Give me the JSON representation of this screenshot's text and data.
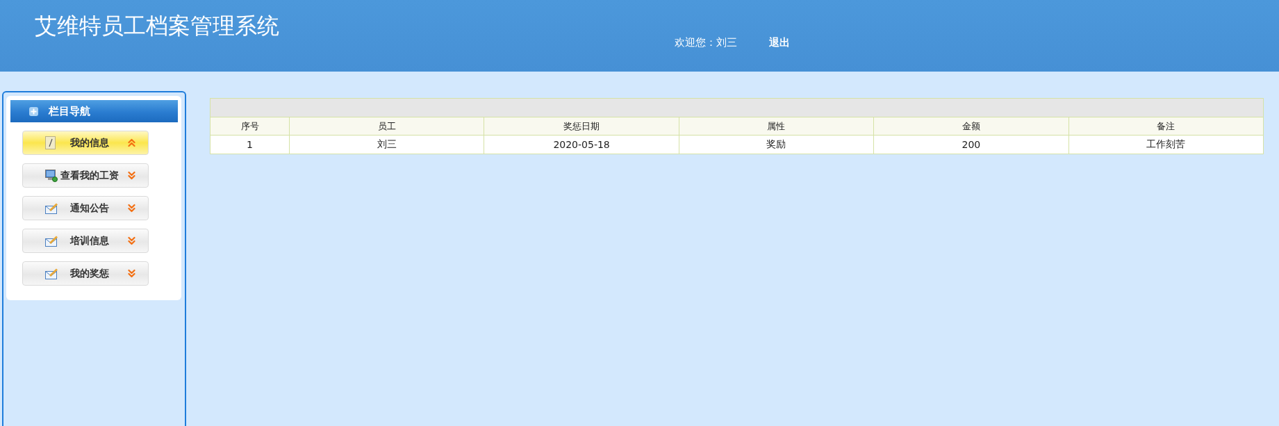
{
  "header": {
    "title": "艾维特员工档案管理系统",
    "welcome": "欢迎您：刘三",
    "logout": "退出"
  },
  "sidebar": {
    "title": "栏目导航",
    "items": [
      {
        "label": "我的信息",
        "selected": true,
        "expanded": true
      },
      {
        "label": "查看我的工资",
        "selected": false,
        "expanded": false
      },
      {
        "label": "通知公告",
        "selected": false,
        "expanded": false
      },
      {
        "label": "培训信息",
        "selected": false,
        "expanded": false
      },
      {
        "label": "我的奖惩",
        "selected": false,
        "expanded": false
      }
    ]
  },
  "table": {
    "columns": [
      "序号",
      "员工",
      "奖惩日期",
      "属性",
      "金额",
      "备注"
    ],
    "rows": [
      [
        "1",
        "刘三",
        "2020-05-18",
        "奖励",
        "200",
        "工作刻苦"
      ]
    ]
  }
}
